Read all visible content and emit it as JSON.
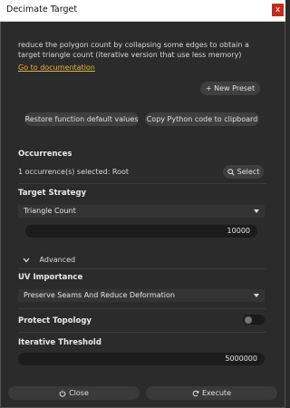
{
  "window": {
    "title": "Decimate Target",
    "close_glyph": "x"
  },
  "description": "reduce the polygon count by collapsing some edges to obtain a target triangle count (iterative version that use less memory)",
  "doc_link": "Go to documentation",
  "buttons": {
    "new_preset": "+ New Preset",
    "restore": "Restore function default values",
    "copy_python": "Copy Python code to clipboard",
    "select": "Select",
    "close": "Close",
    "execute": "Execute"
  },
  "occurrences": {
    "label": "Occurrences",
    "status": "1 occurrence(s) selected: Root"
  },
  "target_strategy": {
    "label": "Target Strategy",
    "selected": "Triangle Count",
    "value": "10000"
  },
  "advanced": {
    "label": "Advanced"
  },
  "uv_importance": {
    "label": "UV Importance",
    "selected": "Preserve Seams And Reduce Deformation"
  },
  "protect_topology": {
    "label": "Protect Topology",
    "enabled": false
  },
  "iterative_threshold": {
    "label": "Iterative Threshold",
    "value": "5000000"
  },
  "icons": {
    "search": "search-icon",
    "close": "power-icon",
    "execute": "refresh-icon",
    "chevron": "chevron-down-icon"
  },
  "colors": {
    "background": "#2b2b2b",
    "link": "#e8b53a",
    "close_button": "#c42b1c"
  }
}
